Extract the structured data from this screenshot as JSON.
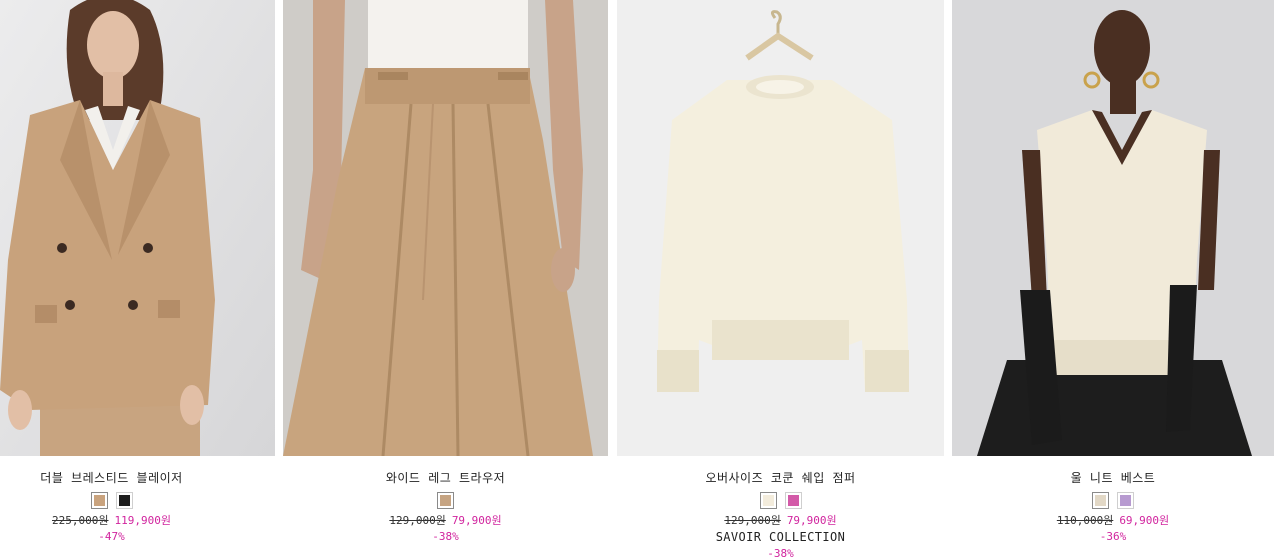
{
  "products": [
    {
      "name": "더블 브레스티드 블레이저",
      "swatches": [
        {
          "color": "#c9a37e",
          "label": "beige"
        },
        {
          "color": "#1d1d1d",
          "label": "black"
        }
      ],
      "old_price": "225,000원",
      "new_price": "119,900원",
      "discount": "-47%",
      "image_icon": "blazer-photo"
    },
    {
      "name": "와이드 레그 트라우저",
      "swatches": [
        {
          "color": "#c6a482",
          "label": "beige"
        }
      ],
      "old_price": "129,000원",
      "new_price": "79,900원",
      "discount": "-38%",
      "image_icon": "trousers-photo"
    },
    {
      "name": "오버사이즈 코쿤 쉐입 점퍼",
      "swatches": [
        {
          "color": "#f3ecdc",
          "label": "cream"
        },
        {
          "color": "#d35aa8",
          "label": "pink"
        }
      ],
      "old_price": "129,000원",
      "new_price": "79,900원",
      "collection": "SAVOIR COLLECTION",
      "discount": "-38%",
      "image_icon": "sweater-photo"
    },
    {
      "name": "울 니트 베스트",
      "swatches": [
        {
          "color": "#e2d8c6",
          "label": "cream"
        },
        {
          "color": "#b79ad0",
          "label": "lilac"
        }
      ],
      "old_price": "110,000원",
      "new_price": "69,900원",
      "discount": "-36%",
      "image_icon": "knit-vest-photo"
    }
  ],
  "colors": {
    "sale": "#d1249e",
    "text": "#222222"
  }
}
